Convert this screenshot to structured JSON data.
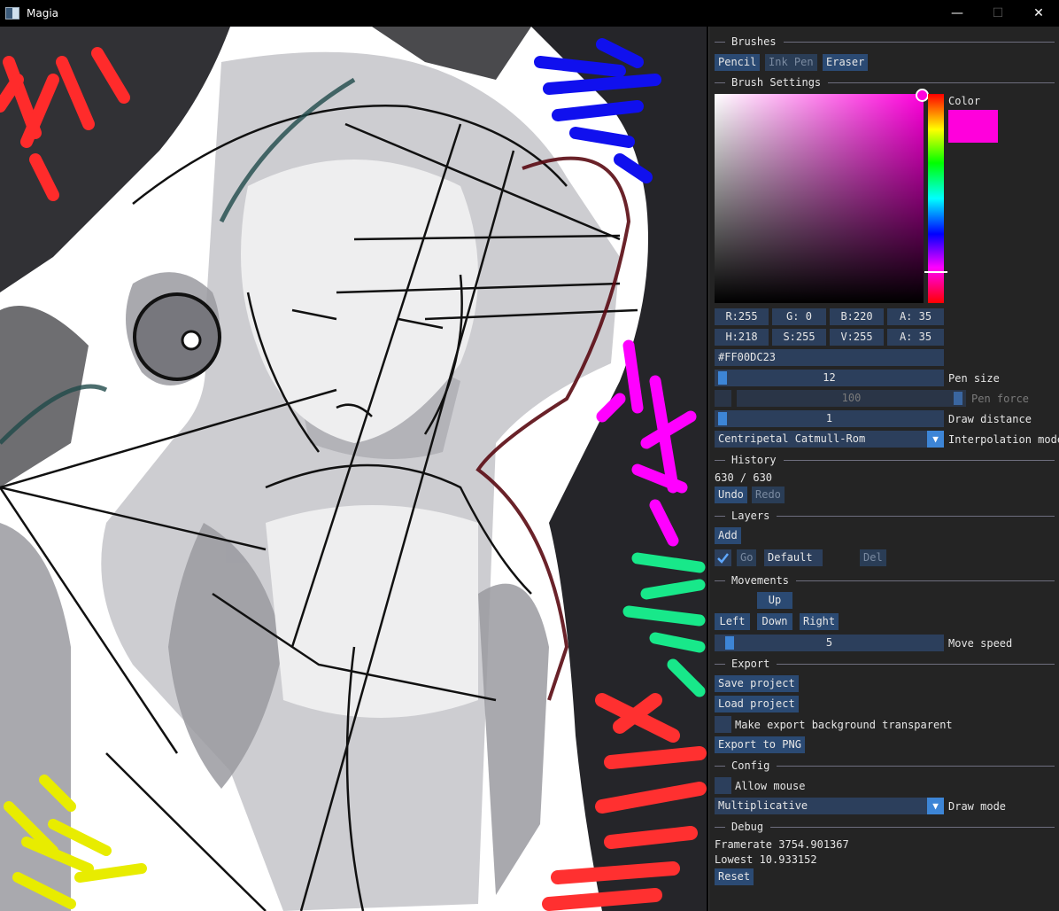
{
  "window": {
    "title": "Magia",
    "minimize": "—",
    "maximize": "☐",
    "close": "✕"
  },
  "brushes": {
    "header": "Brushes",
    "pencil": "Pencil",
    "ink_pen": "Ink Pen",
    "eraser": "Eraser"
  },
  "brush_settings": {
    "header": "Brush Settings",
    "color_label": "Color",
    "current_color": "#FF00DC",
    "rgba": {
      "r": "R:255",
      "g": "G:  0",
      "b": "B:220",
      "a": "A: 35"
    },
    "hsva": {
      "h": "H:218",
      "s": "S:255",
      "v": "V:255",
      "a": "A: 35"
    },
    "hex": "#FF00DC23",
    "pen_size": {
      "value": "12",
      "label": "Pen size",
      "fraction": 0.04
    },
    "pen_force": {
      "value": "100",
      "label": "Pen force"
    },
    "draw_distance": {
      "value": "1",
      "label": "Draw distance",
      "fraction": 0.0
    },
    "interpolation": {
      "value": "Centripetal Catmull-Rom",
      "label": "Interpolation mode"
    }
  },
  "history": {
    "header": "History",
    "count": "630 / 630",
    "undo": "Undo",
    "redo": "Redo"
  },
  "layers": {
    "header": "Layers",
    "add": "Add",
    "go": "Go",
    "layer_name": "Default",
    "delete": "Del"
  },
  "movements": {
    "header": "Movements",
    "up": "Up",
    "left": "Left",
    "down": "Down",
    "right": "Right",
    "speed_value": "5",
    "speed_label": "Move speed",
    "speed_fraction": 0.05
  },
  "export": {
    "header": "Export",
    "save": "Save project",
    "load": "Load project",
    "transparent": "Make export background transparent",
    "export_png": "Export to PNG"
  },
  "config": {
    "header": "Config",
    "allow_mouse": "Allow mouse",
    "draw_mode_value": "Multiplicative",
    "draw_mode_label": "Draw mode"
  },
  "debug": {
    "header": "Debug",
    "framerate": "Framerate 3754.901367",
    "lowest": "Lowest 10.933152",
    "reset": "Reset"
  }
}
